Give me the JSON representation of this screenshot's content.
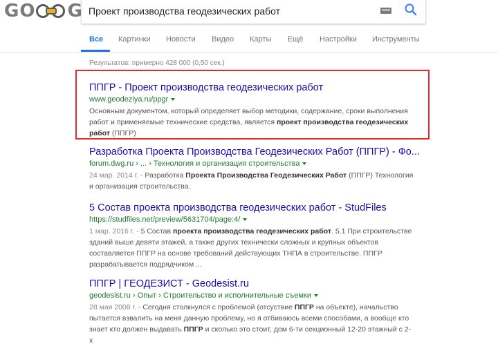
{
  "header": {
    "logo_left": "GO",
    "logo_right": "GLE",
    "query": "Проект производства геодезических работ"
  },
  "tabs": [
    "Все",
    "Картинки",
    "Новости",
    "Видео",
    "Карты",
    "Ещё",
    "Настройки",
    "Инструменты"
  ],
  "stats": "Результатов: примерно 428 000 (0,50 сек.)",
  "results": [
    {
      "title": "ППГР - Проект производства геодезических работ",
      "url": "www.geodeziya.ru/ppgr",
      "snippet_parts": [
        {
          "t": "Основным документом, который определяет выбор методики, содержание, сроки выполнения работ и применяемые технические средства, является "
        },
        {
          "b": "проект производства геодезических работ"
        },
        {
          "t": " (ППГР)"
        }
      ]
    },
    {
      "title": "Разработка Проекта Производства Геодезических Работ (ППГР) - Фо...",
      "url": "forum.dwg.ru › ... › Технология и организация строительства",
      "date": "24 мар. 2014 г. - ",
      "snippet_parts": [
        {
          "t": "Разработка "
        },
        {
          "b": "Проекта Производства Геодезических Работ"
        },
        {
          "t": " (ППГР) Технология и организация строительства."
        }
      ]
    },
    {
      "title": "5 Состав проекта производства геодезических работ - StudFiles",
      "url": "https://studfiles.net/preview/5631704/page:4/",
      "date": "1 мар. 2016 г. - ",
      "snippet_parts": [
        {
          "t": "5 Состав "
        },
        {
          "b": "проекта производства геодезических работ"
        },
        {
          "t": ". 5.1 При строительстве зданий выше девяти этажей, а также других технически сложных и крупных объектов составляется ППГР на основе требований действующих ТНПА в строительстве. ППГР разрабатывается подрядчиком ..."
        }
      ]
    },
    {
      "title": "ППГР | ГЕОДЕЗИСТ - Geodesist.ru",
      "url": "geodesist.ru › Опыт › Строительство и исполнительные съемки",
      "date": "28 мая 2008 г. - ",
      "snippet_parts": [
        {
          "t": "Сегодня столкнулся с проблемой (отсуствие "
        },
        {
          "b": "ППГР"
        },
        {
          "t": " на объекте), начальство пытается взвалить на меня данную проблему, но я отбиваюсь всеми способами, а вообще кто знает кто должен выдавать "
        },
        {
          "b": "ППГР"
        },
        {
          "t": " и сколько это стоит, дом 6-ти секционный 12-20 этажный с 2-х"
        }
      ]
    }
  ],
  "colors": {
    "link": "#1a0dab",
    "url": "#1e7b33",
    "accent": "#1a73e8",
    "highlight_box": "#e8262b"
  }
}
